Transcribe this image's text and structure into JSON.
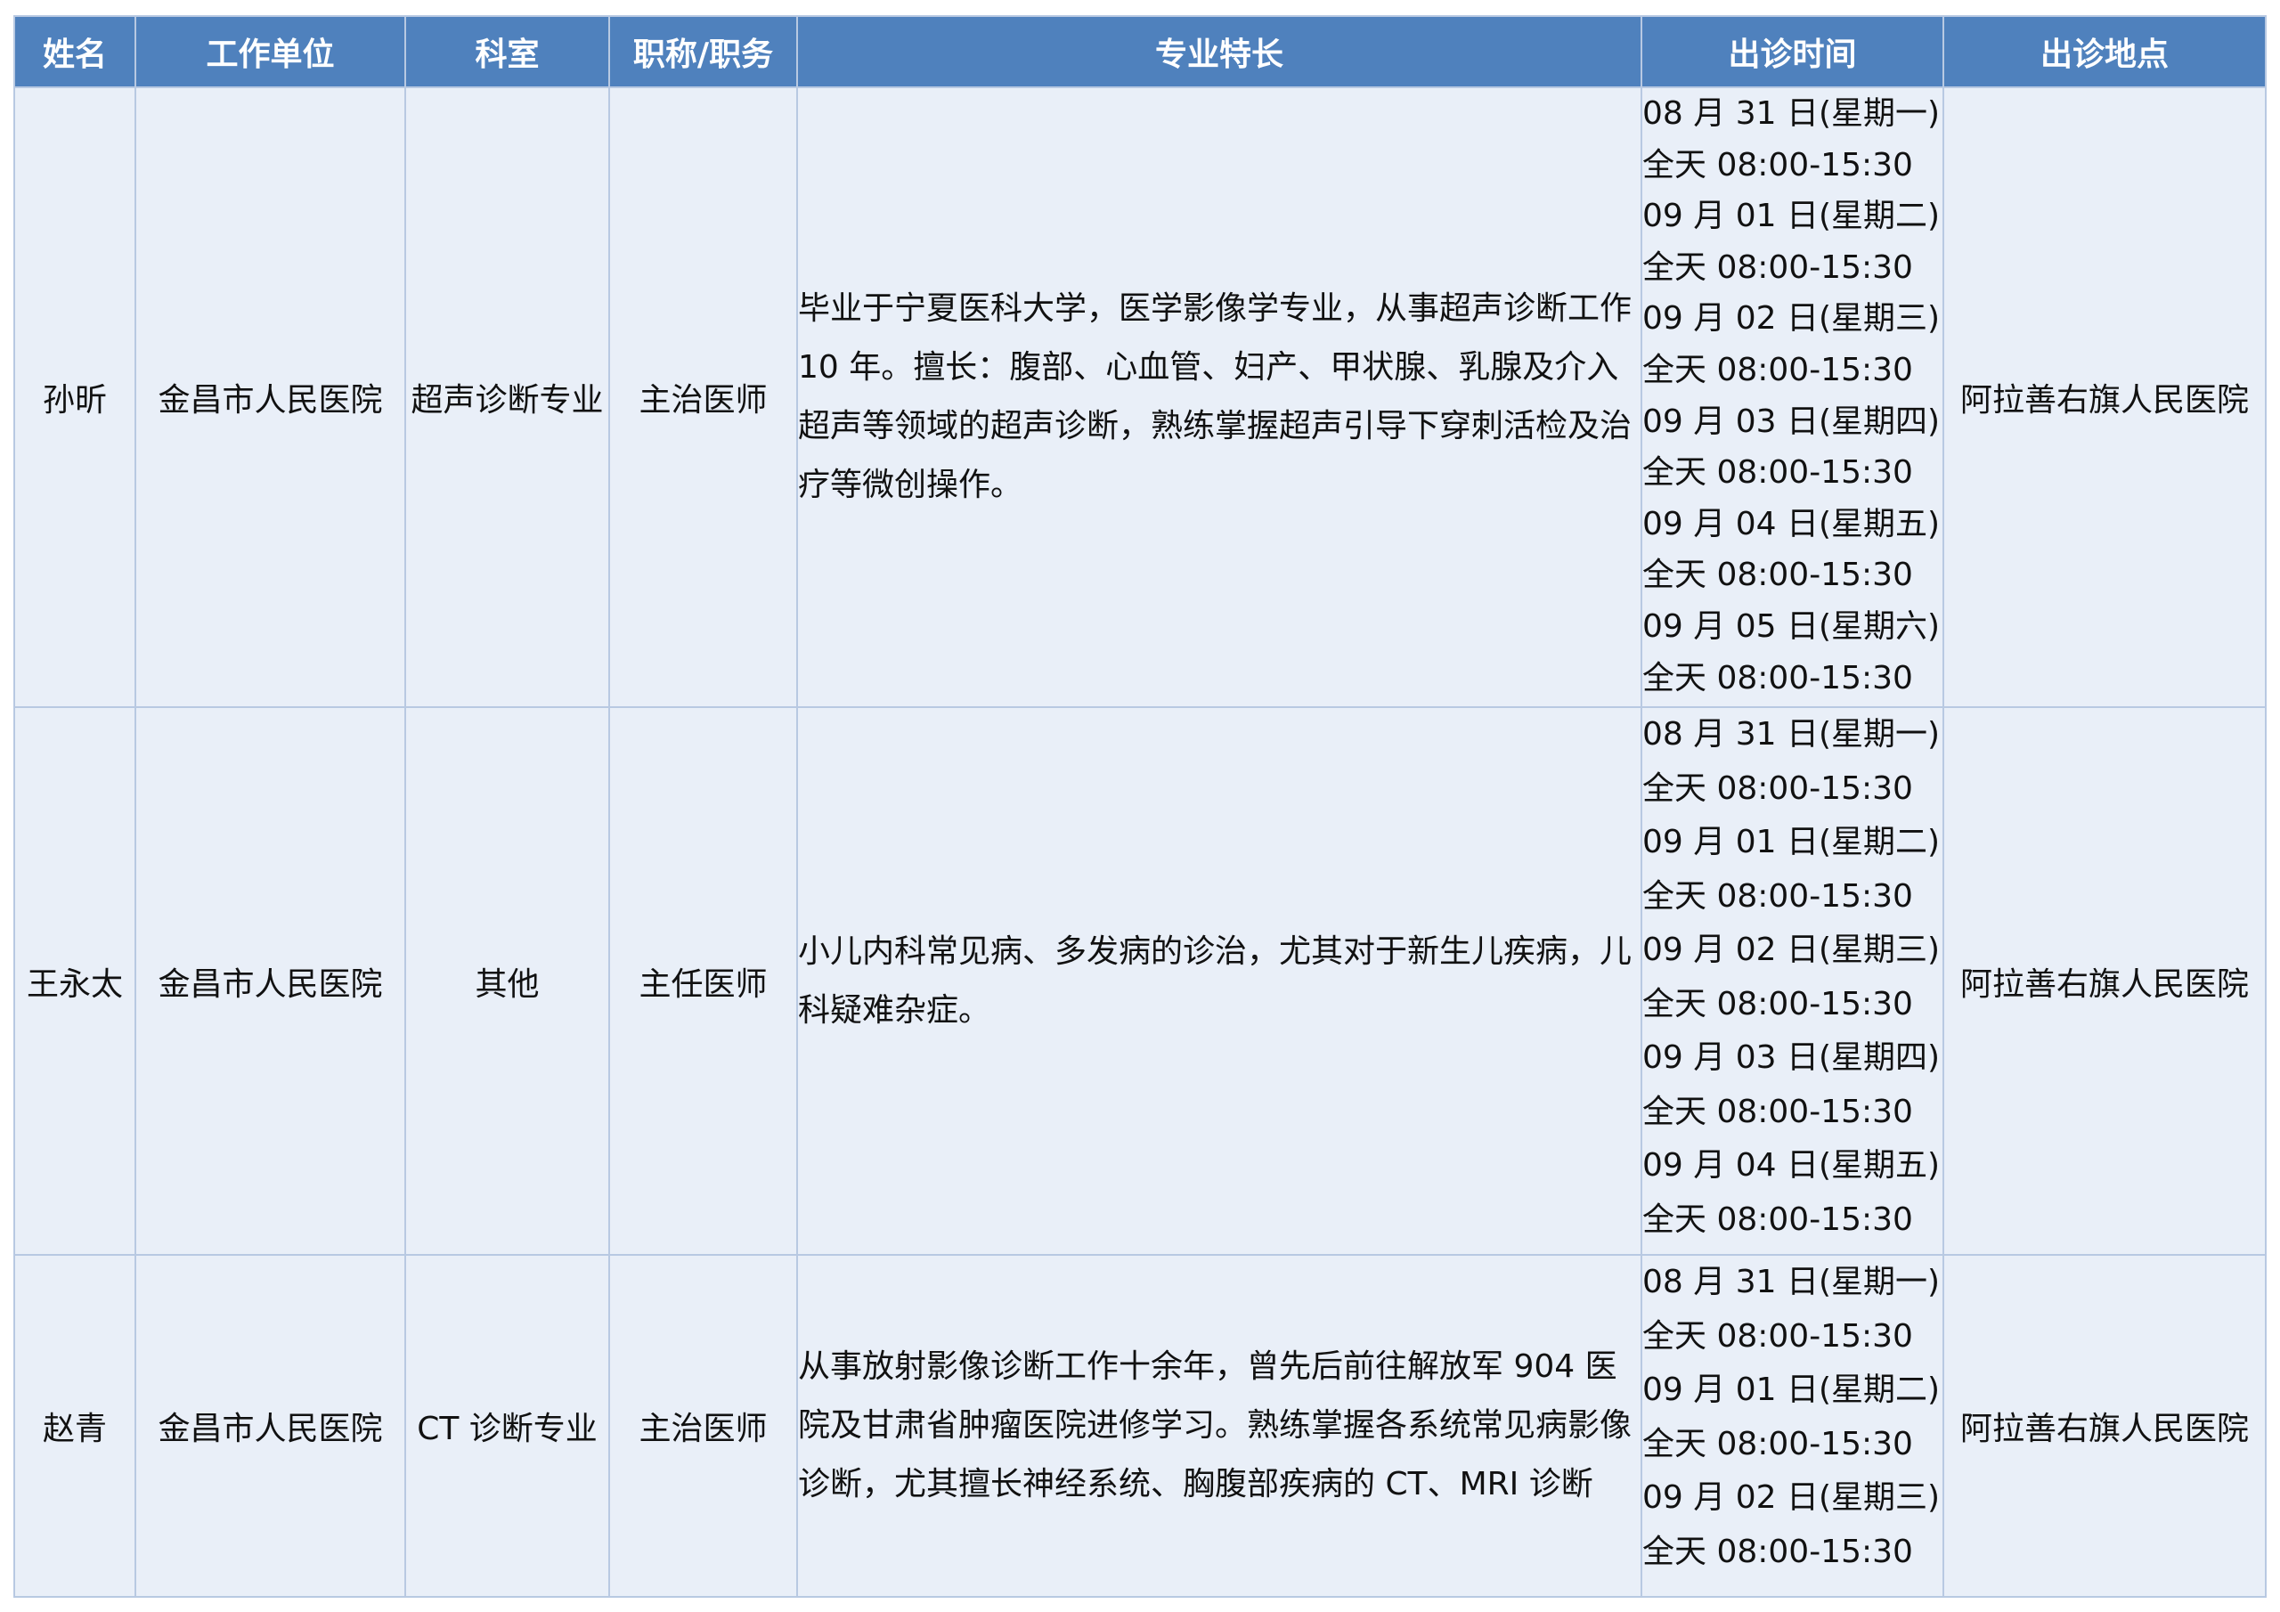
{
  "headers": [
    "姓名",
    "工作单位",
    "科室",
    "职称/职务",
    "专业特长",
    "出诊时间",
    "出诊地点"
  ],
  "rows": [
    {
      "name": "孙昕",
      "unit": "金昌市人民医院",
      "dept": "超声诊断专业",
      "title": "主治医师",
      "specialty": "毕业于宁夏医科大学，医学影像学专业，从事超声诊断工作 10 年。擅长：腹部、心血管、妇产、甲状腺、乳腺及介入超声等领域的超声诊断，熟练掌握超声引导下穿刺活检及治疗等微创操作。",
      "schedule": [
        "08 月 31 日(星期一)",
        "全天 08:00-15:30",
        "09 月 01 日(星期二)",
        "全天 08:00-15:30",
        "09 月 02 日(星期三)",
        "全天 08:00-15:30",
        "09 月 03 日(星期四)",
        "全天 08:00-15:30",
        "09 月 04 日(星期五)",
        "全天 08:00-15:30",
        "09 月 05 日(星期六)",
        "全天 08:00-15:30"
      ],
      "location": "阿拉善右旗人民医院"
    },
    {
      "name": "王永太",
      "unit": "金昌市人民医院",
      "dept": "其他",
      "title": "主任医师",
      "specialty": "小儿内科常见病、多发病的诊治，尤其对于新生儿疾病，儿科疑难杂症。",
      "schedule": [
        "08 月 31 日(星期一)",
        "全天 08:00-15:30",
        "09 月 01 日(星期二)",
        "全天 08:00-15:30",
        "09 月 02 日(星期三)",
        "全天 08:00-15:30",
        "09 月 03 日(星期四)",
        "全天 08:00-15:30",
        "09 月 04 日(星期五)",
        "全天 08:00-15:30"
      ],
      "location": "阿拉善右旗人民医院"
    },
    {
      "name": "赵青",
      "unit": "金昌市人民医院",
      "dept": "CT 诊断专业",
      "title": "主治医师",
      "specialty": "从事放射影像诊断工作十余年，曾先后前往解放军 904 医院及甘肃省肿瘤医院进修学习。熟练掌握各系统常见病影像诊断，尤其擅长神经系统、胸腹部疾病的 CT、MRI 诊断",
      "schedule": [
        "08 月 31 日(星期一)",
        "全天 08:00-15:30",
        "09 月 01 日(星期二)",
        "全天 08:00-15:30",
        "09 月 02 日(星期三)",
        "全天 08:00-15:30"
      ],
      "location": "阿拉善右旗人民医院"
    }
  ]
}
